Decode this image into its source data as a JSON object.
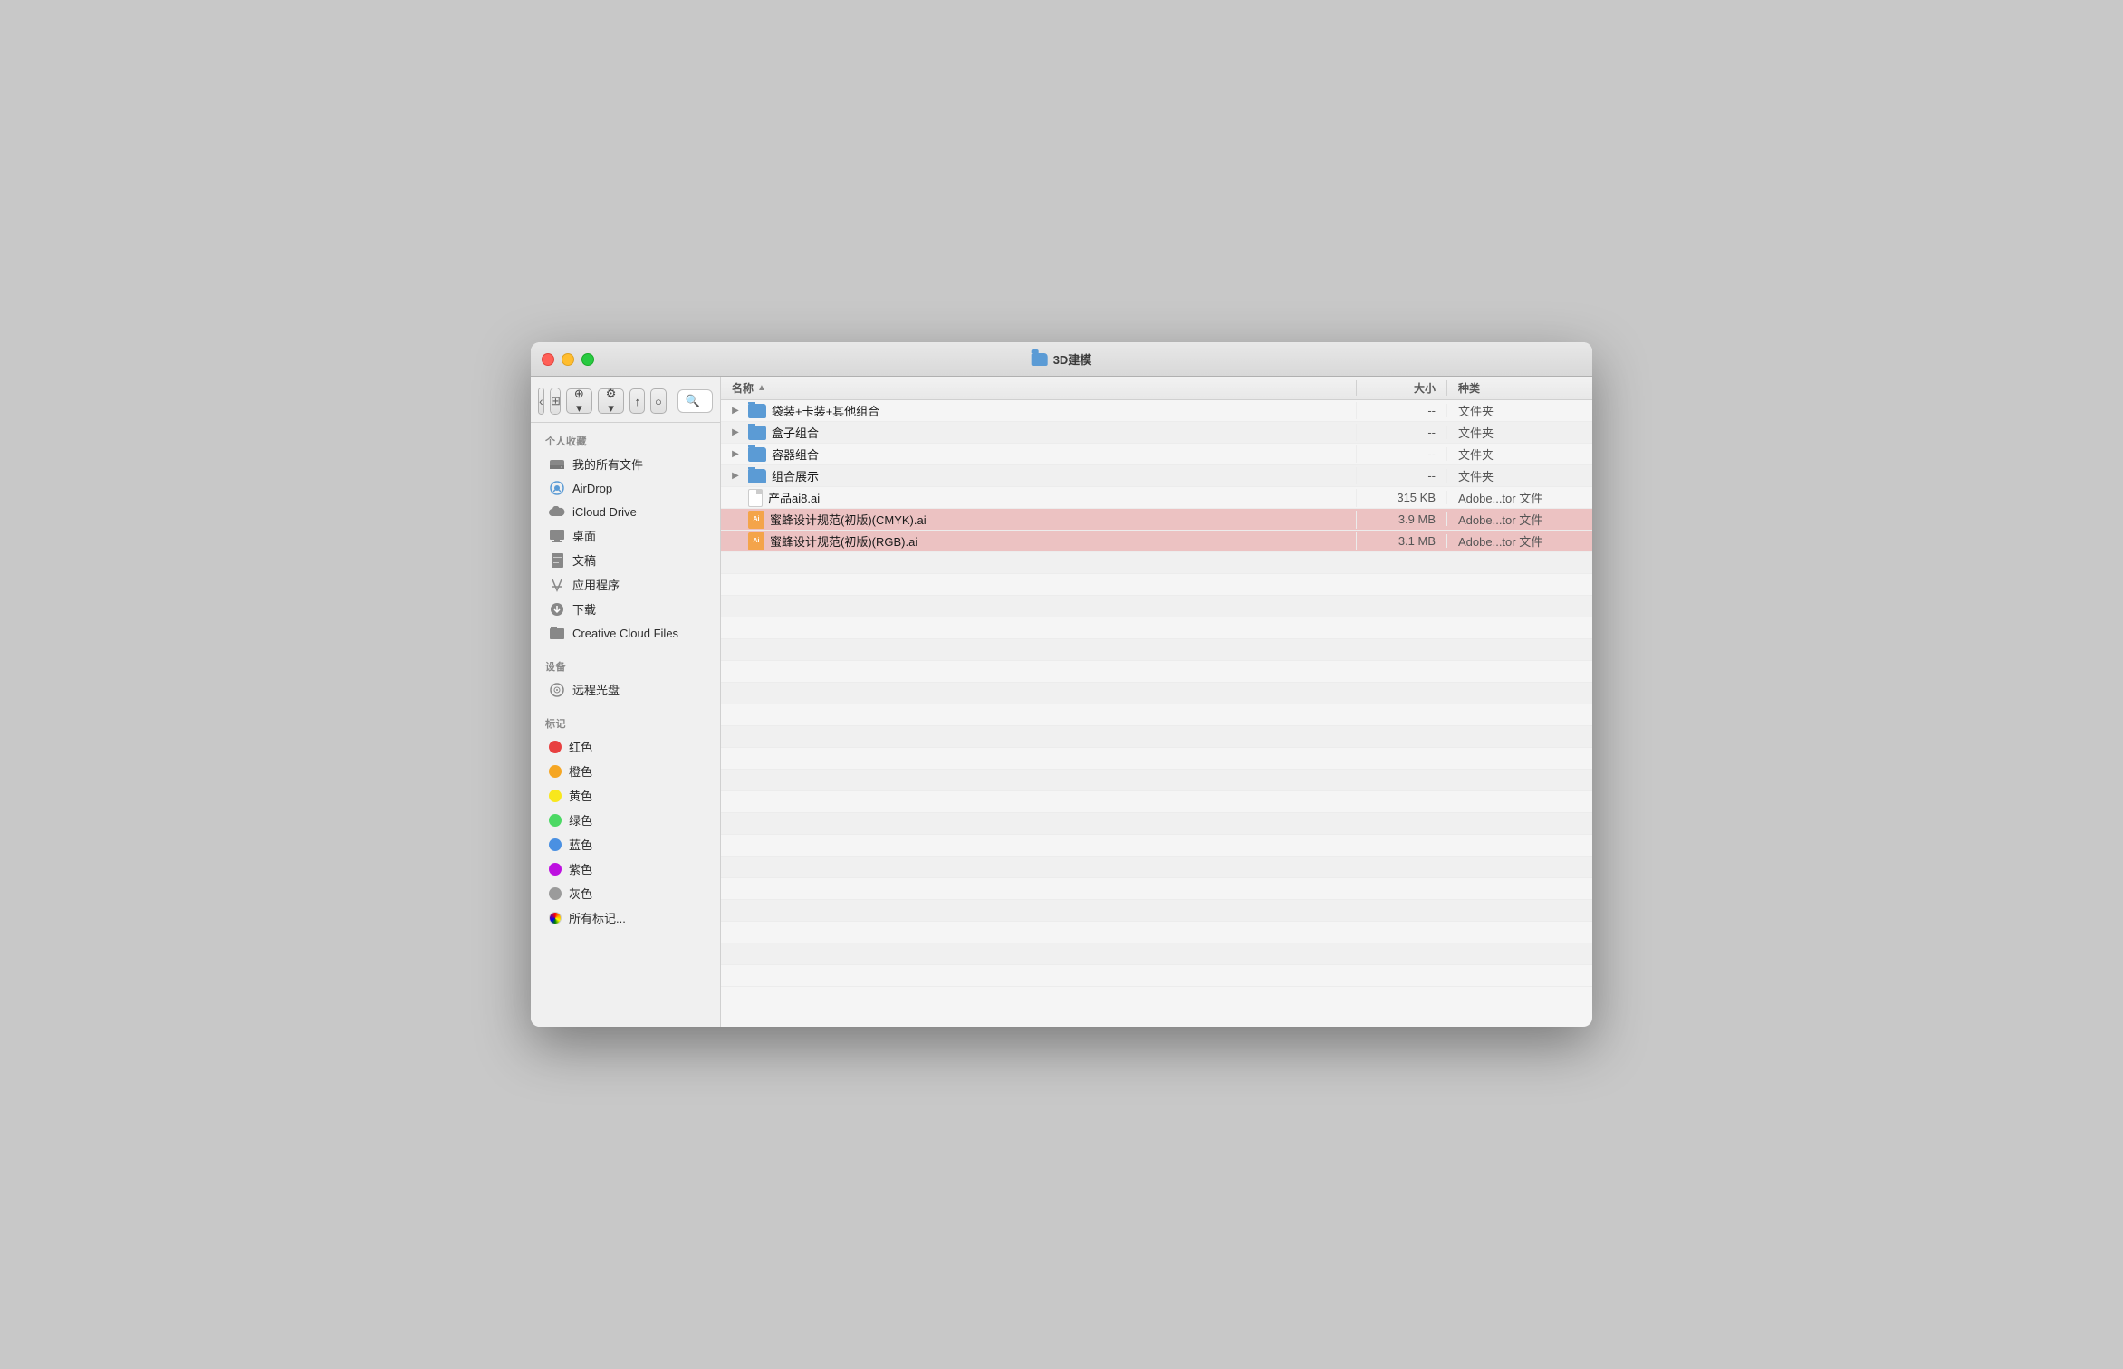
{
  "window": {
    "title": "3D建模",
    "title_folder_color": "#5b9bd5"
  },
  "toolbar": {
    "back_label": "‹",
    "forward_label": "›",
    "view_icon_label": "⊞",
    "view_list_label": "☰",
    "view_column_label": "⊟",
    "view_cover_label": "⊠",
    "arrange_label": "⊕",
    "arrange_arrow": "▾",
    "action_label": "⊗",
    "action_arrow": "▾",
    "share_label": "↑",
    "tag_label": "○",
    "search_placeholder": "搜索"
  },
  "sidebar": {
    "section_favorites": "个人收藏",
    "section_devices": "设备",
    "section_tags": "标记",
    "items_favorites": [
      {
        "id": "all-files",
        "label": "我的所有文件",
        "icon": "hdd"
      },
      {
        "id": "airdrop",
        "label": "AirDrop",
        "icon": "airdrop"
      },
      {
        "id": "icloud",
        "label": "iCloud Drive",
        "icon": "cloud"
      },
      {
        "id": "desktop",
        "label": "桌面",
        "icon": "desktop"
      },
      {
        "id": "documents",
        "label": "文稿",
        "icon": "doc"
      },
      {
        "id": "apps",
        "label": "应用程序",
        "icon": "apps"
      },
      {
        "id": "downloads",
        "label": "下载",
        "icon": "download"
      },
      {
        "id": "cc-files",
        "label": "Creative Cloud Files",
        "icon": "cc"
      }
    ],
    "items_devices": [
      {
        "id": "optical",
        "label": "远程光盘",
        "icon": "optical"
      }
    ],
    "items_tags": [
      {
        "id": "red",
        "label": "红色",
        "color": "#e84040"
      },
      {
        "id": "orange",
        "label": "橙色",
        "color": "#f5a623"
      },
      {
        "id": "yellow",
        "label": "黄色",
        "color": "#f8e71c"
      },
      {
        "id": "green",
        "label": "绿色",
        "color": "#4cd964"
      },
      {
        "id": "blue",
        "label": "蓝色",
        "color": "#4a90e2"
      },
      {
        "id": "purple",
        "label": "紫色",
        "color": "#bd10e0"
      },
      {
        "id": "gray",
        "label": "灰色",
        "color": "#9b9b9b"
      },
      {
        "id": "all-tags",
        "label": "所有标记...",
        "color": null
      }
    ]
  },
  "column_headers": {
    "name": "名称",
    "size": "大小",
    "kind": "种类"
  },
  "files": [
    {
      "id": 1,
      "name": "袋装+卡装+其他组合",
      "type": "folder",
      "size": "--",
      "kind": "文件夹",
      "indent": 0,
      "expandable": true
    },
    {
      "id": 2,
      "name": "盒子组合",
      "type": "folder",
      "size": "--",
      "kind": "文件夹",
      "indent": 0,
      "expandable": true
    },
    {
      "id": 3,
      "name": "容器组合",
      "type": "folder",
      "size": "--",
      "kind": "文件夹",
      "indent": 0,
      "expandable": true
    },
    {
      "id": 4,
      "name": "组合展示",
      "type": "folder",
      "size": "--",
      "kind": "文件夹",
      "indent": 0,
      "expandable": true
    },
    {
      "id": 5,
      "name": "产品ai8.ai",
      "type": "doc",
      "size": "315 KB",
      "kind": "Adobe...tor 文件",
      "indent": 0,
      "expandable": false
    },
    {
      "id": 6,
      "name": "蜜蜂设计规范(初版)(CMYK).ai",
      "type": "ai",
      "size": "3.9 MB",
      "kind": "Adobe...tor 文件",
      "indent": 0,
      "expandable": false,
      "selected": true
    },
    {
      "id": 7,
      "name": "蜜蜂设计规范(初版)(RGB).ai",
      "type": "ai",
      "size": "3.1 MB",
      "kind": "Adobe...tor 文件",
      "indent": 0,
      "expandable": false,
      "selected": true
    }
  ]
}
